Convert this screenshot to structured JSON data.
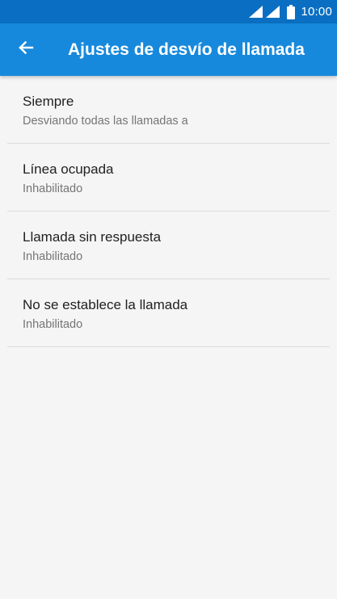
{
  "status_bar": {
    "time": "10:00",
    "background": "#0a6fc2",
    "icons": [
      "signal-icon",
      "signal-icon",
      "battery-icon"
    ]
  },
  "app_bar": {
    "title": "Ajustes de desvío de llamada",
    "back_icon": "arrow-back-icon",
    "background": "#1789dc"
  },
  "settings": {
    "items": [
      {
        "title": "Siempre",
        "summary": "Desviando todas las llamadas a"
      },
      {
        "title": "Línea ocupada",
        "summary": "Inhabilitado"
      },
      {
        "title": "Llamada sin respuesta",
        "summary": "Inhabilitado"
      },
      {
        "title": "No se establece la llamada",
        "summary": "Inhabilitado"
      }
    ]
  }
}
